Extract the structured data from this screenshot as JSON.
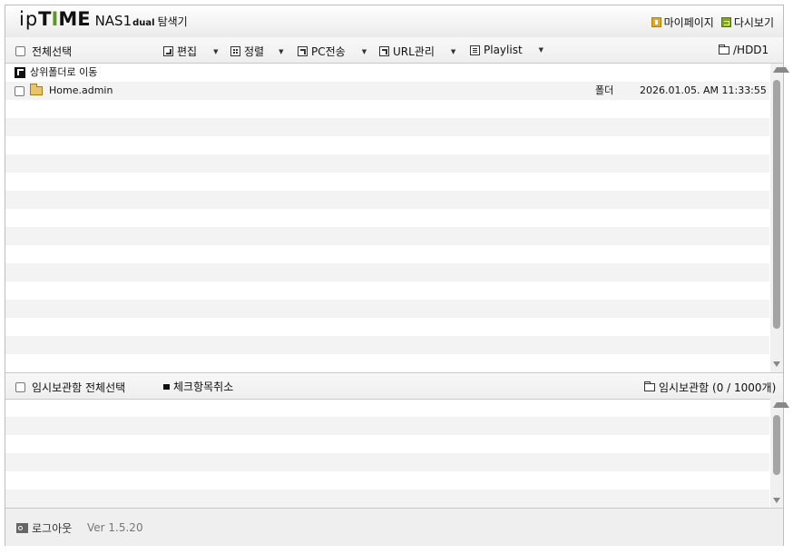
{
  "header": {
    "logo_ip": "ip",
    "logo_t": "T",
    "logo_i": "I",
    "logo_me": "ME",
    "logo_nas": "NAS1",
    "logo_dual": "dual",
    "logo_explorer": "탐색기",
    "mypage_label": "마이페이지",
    "refresh_label": "다시보기",
    "mypage_icon": "user-icon",
    "refresh_icon": "refresh-icon",
    "logo_green": "#5a9a1e"
  },
  "toolbar": {
    "select_all": "전체선택",
    "edit": "편집",
    "sort": "정렬",
    "pc_transfer": "PC전송",
    "url_manage": "URL관리",
    "playlist": "Playlist",
    "path": "/HDD1"
  },
  "list": {
    "up_label": "상위폴더로 이동",
    "items": [
      {
        "name": "Home.admin",
        "type": "폴더",
        "date": "2026.01.05. AM 11:33:55"
      }
    ]
  },
  "temp_bar": {
    "select_all": "임시보관함 전체선택",
    "uncheck": "체크항목취소",
    "storage_label": "임시보관함 (0 / 1000개)"
  },
  "footer": {
    "logout": "로그아웃",
    "version": "Ver 1.5.20"
  }
}
